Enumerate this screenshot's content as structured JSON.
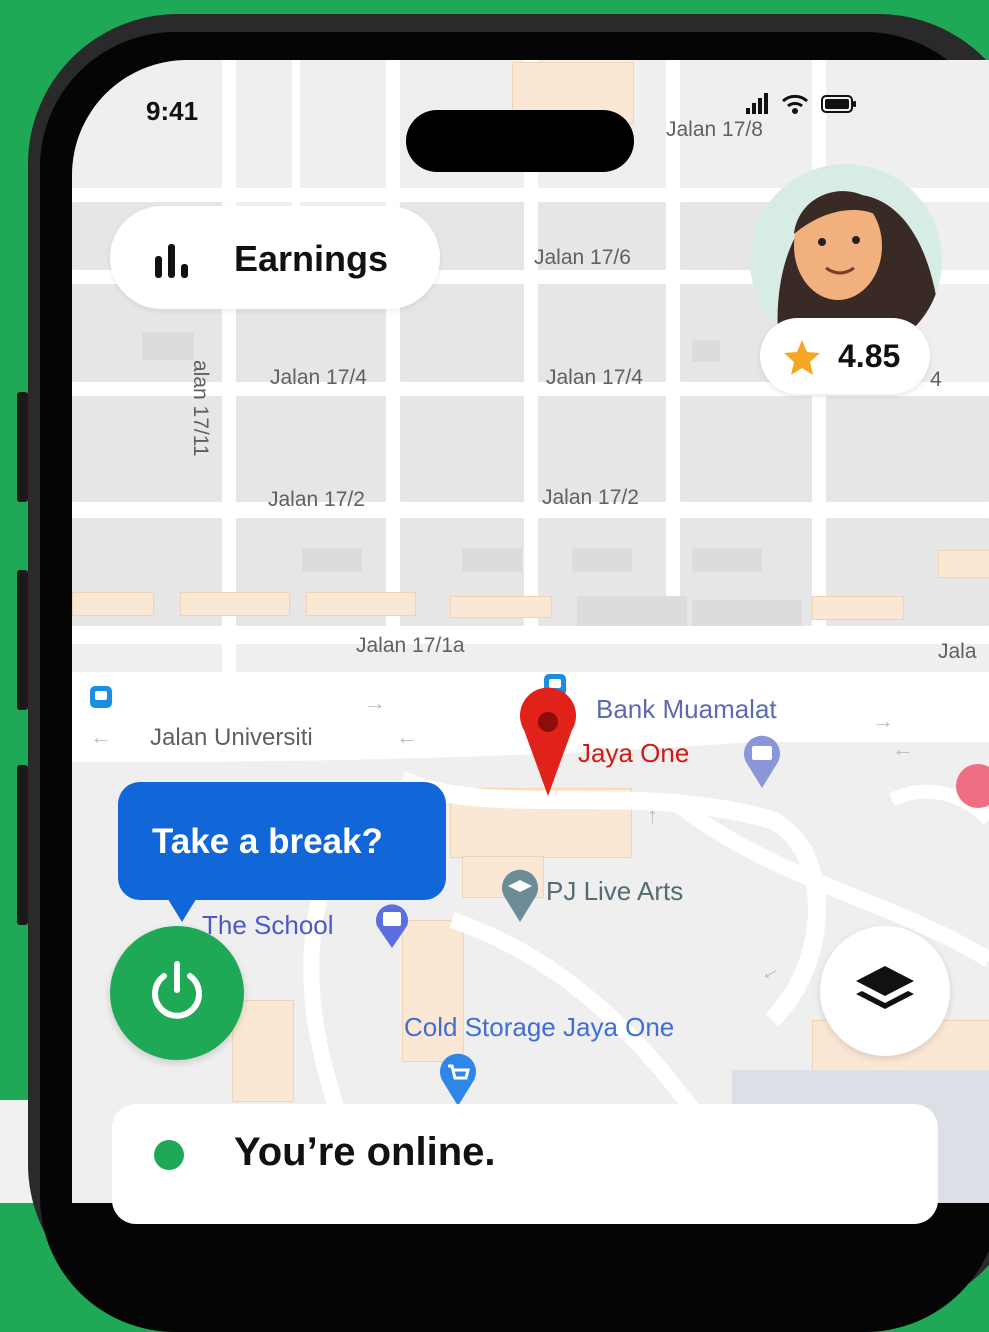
{
  "status_bar": {
    "time": "9:41"
  },
  "earnings": {
    "label": "Earnings"
  },
  "driver": {
    "rating": "4.85"
  },
  "map": {
    "streets": [
      "Jalan 17/8",
      "Jalan 17/6",
      "Jalan 17/4",
      "Jalan 17/4",
      "alan 17/11",
      "Jalan 17/2",
      "Jalan 17/2",
      "Jalan 17/1a",
      "Jalan Universiti",
      "Jala",
      "4"
    ],
    "places": {
      "bank": "Bank Muamalat",
      "pin": "Jaya One",
      "arts": "PJ Live Arts",
      "school": "The School",
      "store": "Cold Storage Jaya One"
    }
  },
  "prompt": {
    "text": "Take a break?"
  },
  "status": {
    "text": "You’re online."
  },
  "colors": {
    "brand": "#1fa855",
    "tooltip": "#1167d8",
    "pin": "#e0221a"
  }
}
